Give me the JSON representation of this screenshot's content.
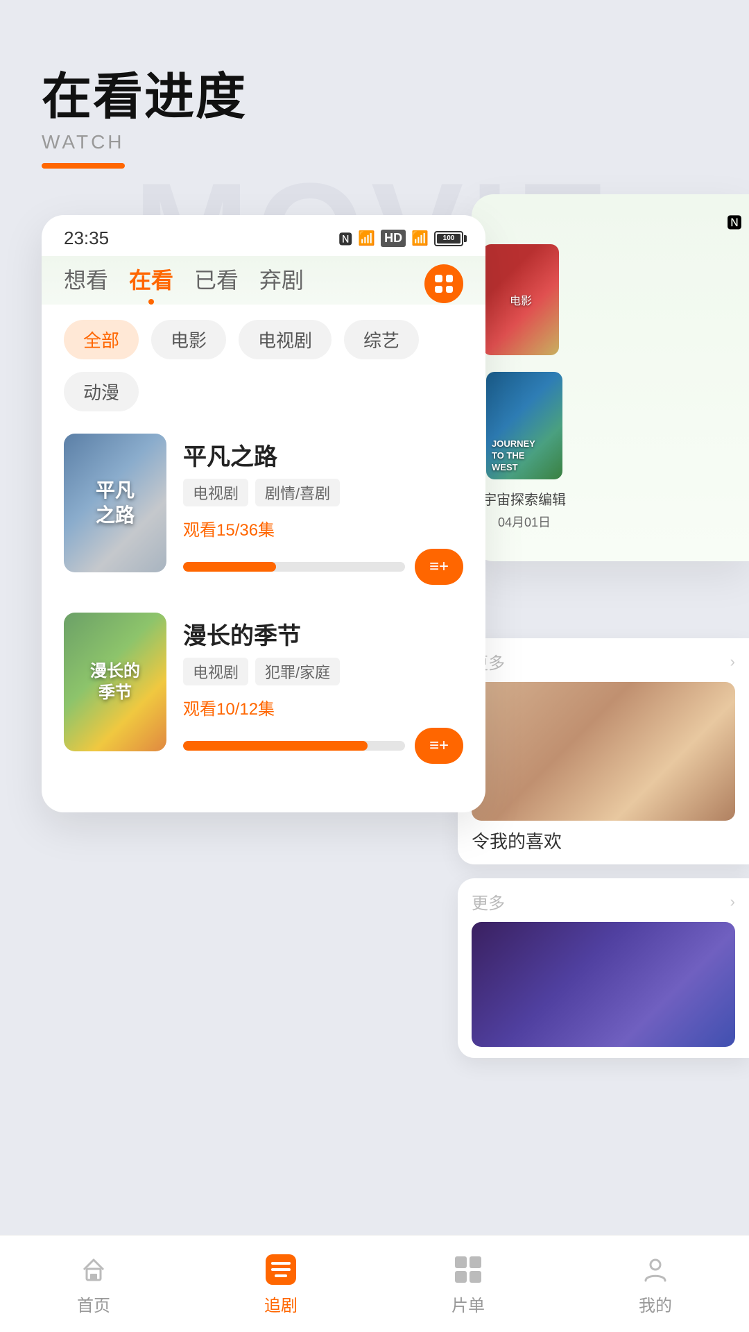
{
  "header": {
    "title_main": "在看进度",
    "title_sub": "WATCH",
    "bg_text": "MOVIE"
  },
  "statusbar": {
    "time": "23:35"
  },
  "tabs": [
    {
      "label": "想看",
      "active": false
    },
    {
      "label": "在看",
      "active": true
    },
    {
      "label": "已看",
      "active": false
    },
    {
      "label": "弃剧",
      "active": false
    }
  ],
  "filters": [
    {
      "label": "全部",
      "active": true
    },
    {
      "label": "电影",
      "active": false
    },
    {
      "label": "电视剧",
      "active": false
    },
    {
      "label": "综艺",
      "active": false
    },
    {
      "label": "动漫",
      "active": false
    }
  ],
  "movies": [
    {
      "title": "平凡之路",
      "poster_text": "平凡\n之路",
      "tags": [
        "电视剧",
        "剧情/喜剧"
      ],
      "progress_text": "观看15/36集",
      "progress_pct": 42,
      "poster_class": "poster-1"
    },
    {
      "title": "漫长的季节",
      "poster_text": "漫长的\n季节",
      "tags": [
        "电视剧",
        "犯罪/家庭"
      ],
      "progress_text": "观看10/12集",
      "progress_pct": 83,
      "poster_class": "poster-2"
    }
  ],
  "right_card": {
    "movie1_title": "宇宙探索编辑",
    "movie1_date": "04月01日"
  },
  "bottom_cards": [
    {
      "more": "更多",
      "title": "令我的喜欢",
      "poster_class": "bottom-poster-1"
    },
    {
      "more": "更多",
      "title": "",
      "poster_class": "bottom-poster-2"
    }
  ],
  "bottom_nav": [
    {
      "label": "首页",
      "active": false,
      "icon": "home"
    },
    {
      "label": "追剧",
      "active": true,
      "icon": "list"
    },
    {
      "label": "片单",
      "active": false,
      "icon": "grid"
    },
    {
      "label": "我的",
      "active": false,
      "icon": "user"
    }
  ]
}
